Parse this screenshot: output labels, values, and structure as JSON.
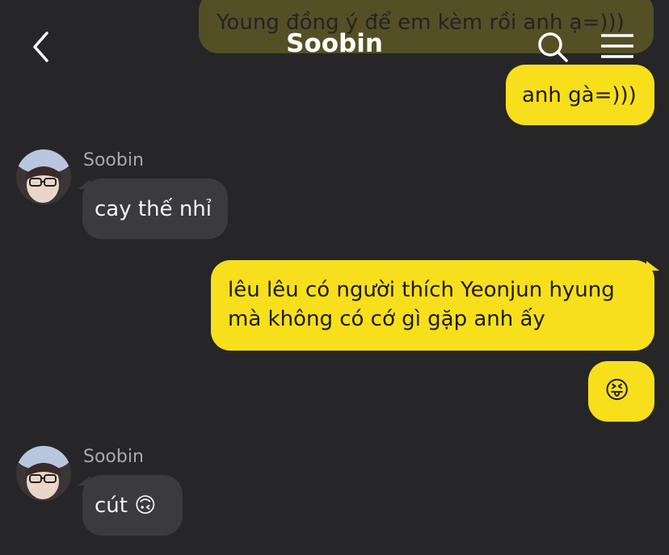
{
  "header": {
    "title": "Soobin",
    "back_icon": "back-arrow-icon",
    "search_icon": "search-icon",
    "menu_icon": "menu-icon"
  },
  "messages": [
    {
      "from": "me",
      "text": "Young đồng ý để em kèm rồi anh ạ=)))"
    },
    {
      "from": "me",
      "text": "anh gà=)))"
    },
    {
      "from": "them",
      "sender": "Soobin",
      "text": "cay thế nhỉ"
    },
    {
      "from": "me",
      "lines": [
        "lêu lêu có người thích Yeonjun hyung",
        "mà không có cớ gì gặp anh ấy"
      ]
    },
    {
      "from": "me",
      "text": "😝"
    },
    {
      "from": "them",
      "sender": "Soobin",
      "text": "cút 🙃"
    }
  ],
  "colors": {
    "background": "#262628",
    "my_bubble": "#f7df1c",
    "their_bubble": "#3b3b3d"
  }
}
